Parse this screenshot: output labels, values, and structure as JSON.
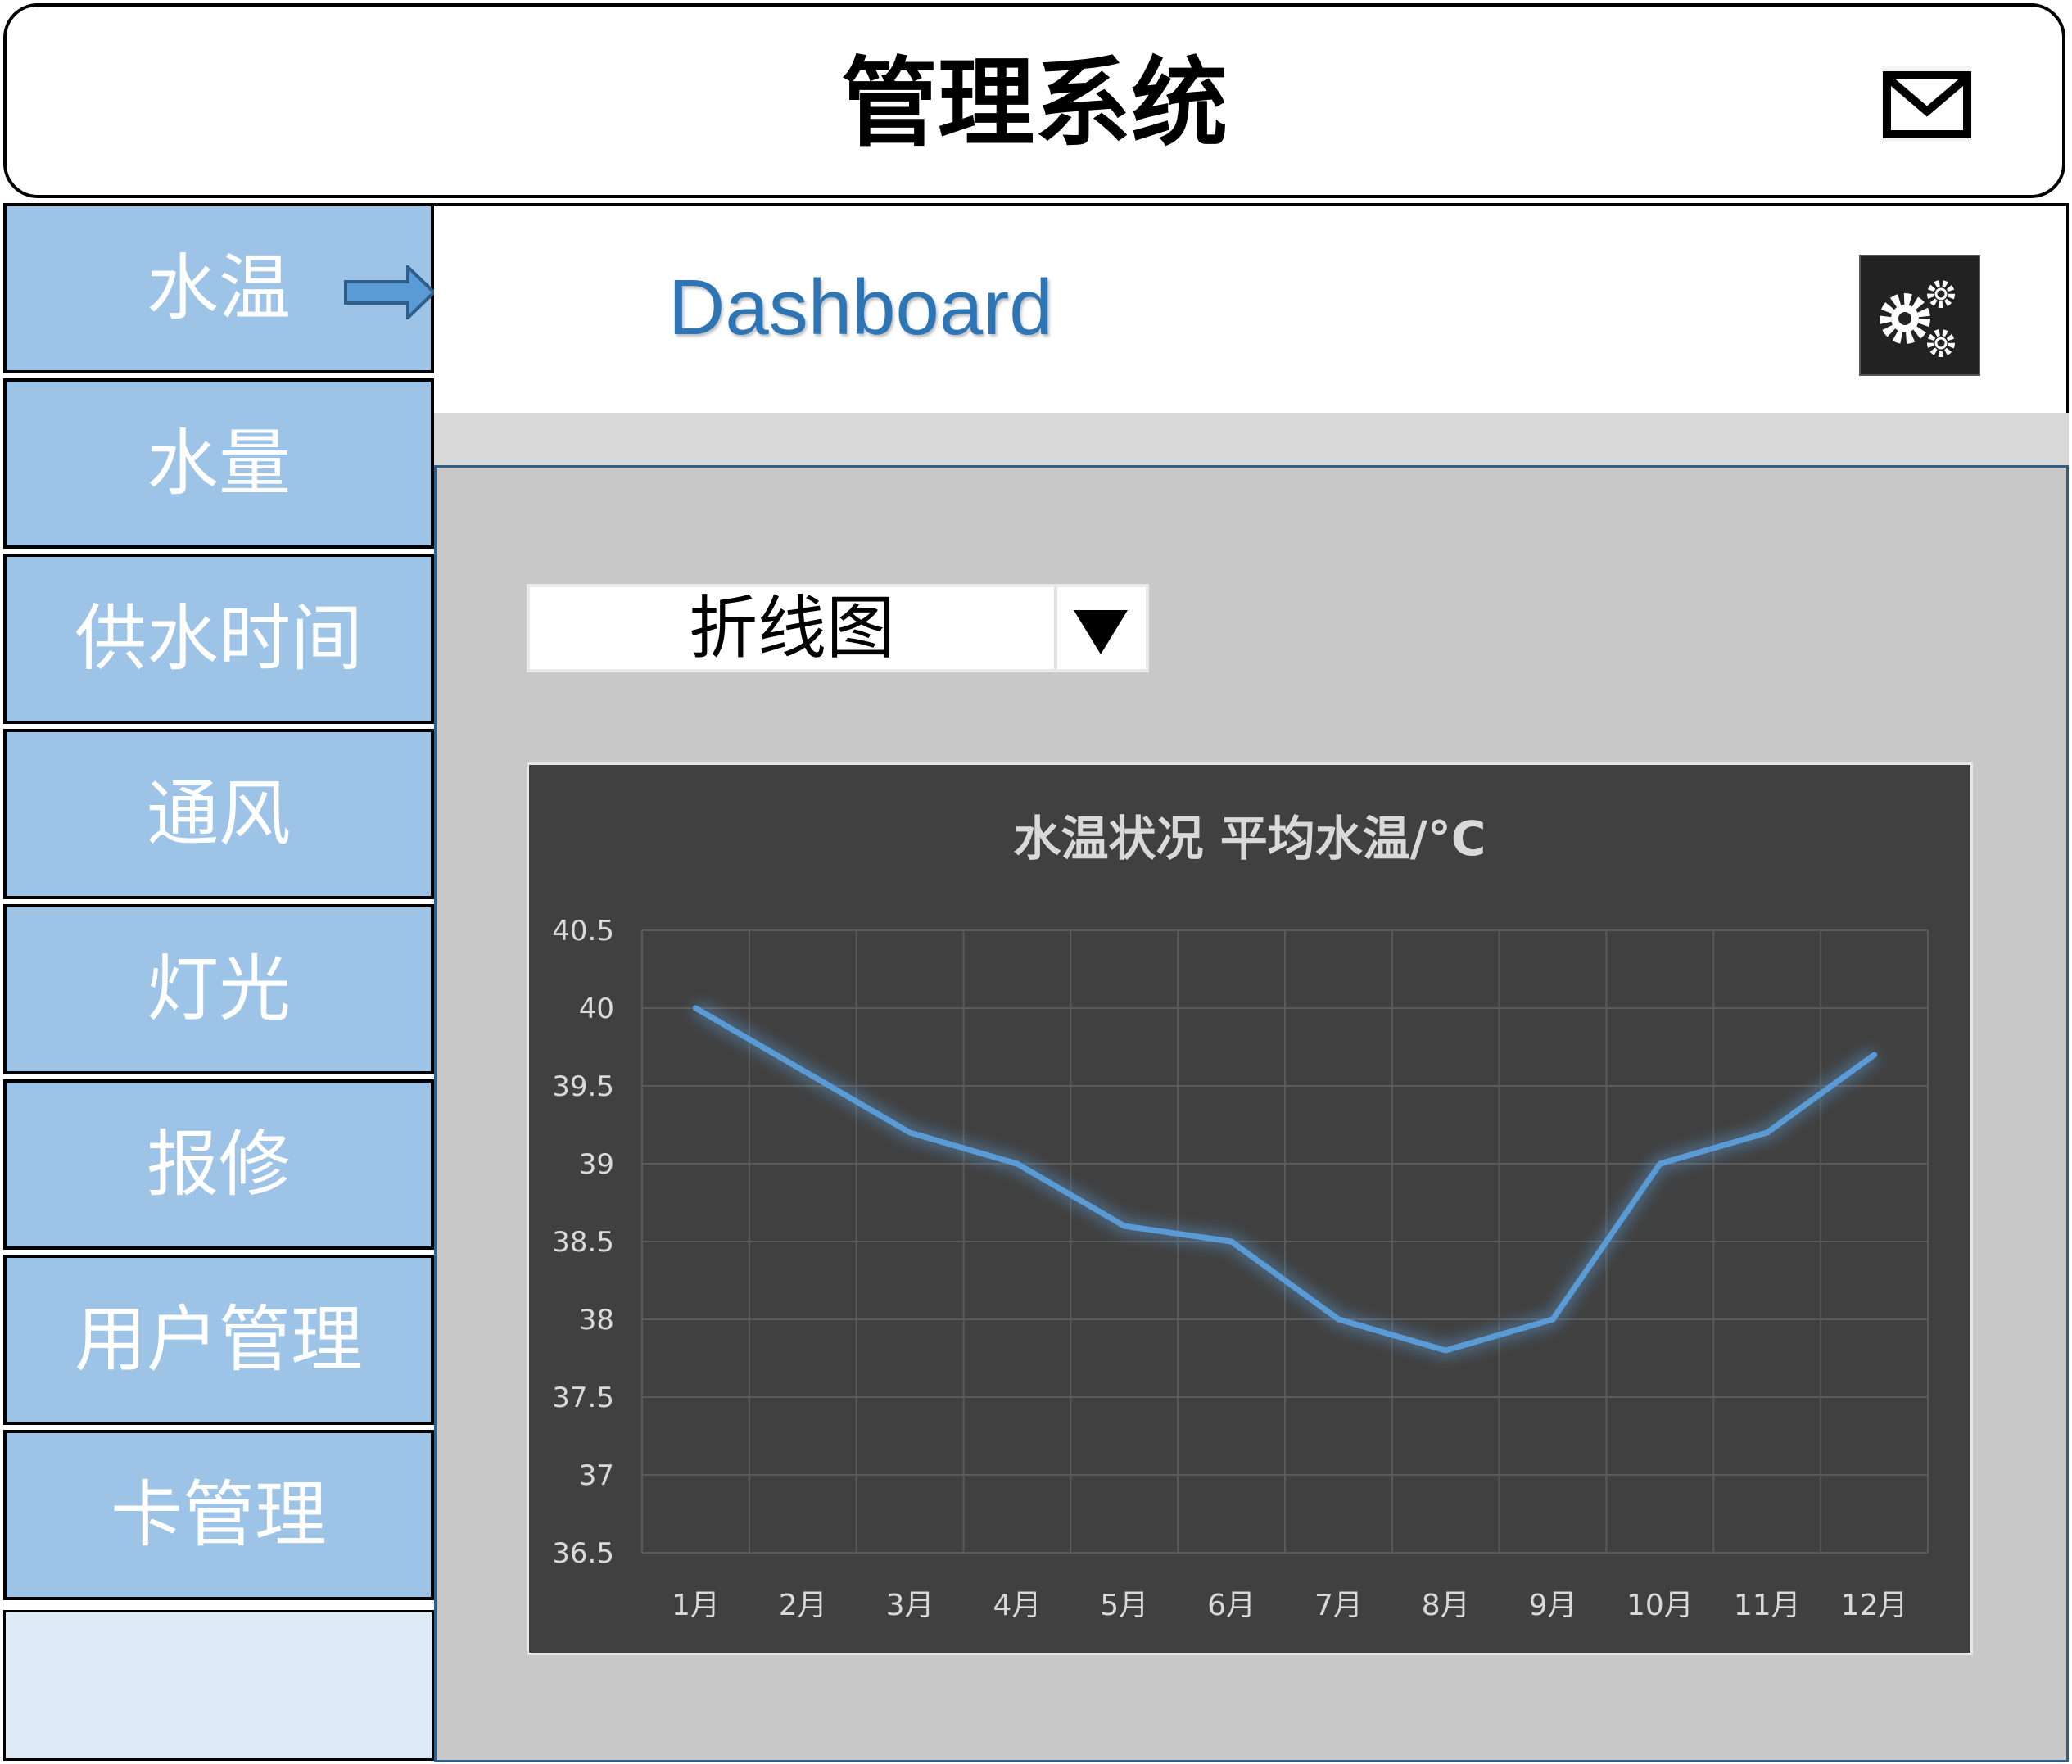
{
  "app": {
    "title": "管理系统"
  },
  "header": {
    "mail_icon": "mail-icon"
  },
  "sidebar": {
    "items": [
      {
        "label": "水温",
        "selected": true
      },
      {
        "label": "水量"
      },
      {
        "label": "供水时间"
      },
      {
        "label": "通风"
      },
      {
        "label": "灯光"
      },
      {
        "label": "报修"
      },
      {
        "label": "用户管理"
      },
      {
        "label": "卡管理"
      }
    ],
    "selected_indicator_icon": "arrow-right-icon"
  },
  "topbar": {
    "title": "Dashboard",
    "settings_icon": "gears-icon"
  },
  "chart_selector": {
    "value": "折线图",
    "dropdown_icon": "triangle-down-icon"
  },
  "colors": {
    "sidebar_bg": "#9dc3e6",
    "accent": "#2e75b6",
    "chart_bg": "#404040",
    "line": "#5b9bd5"
  },
  "chart_data": {
    "type": "line",
    "title": "水温状况 平均水温/°C",
    "categories": [
      "1月",
      "2月",
      "3月",
      "4月",
      "5月",
      "6月",
      "7月",
      "8月",
      "9月",
      "10月",
      "11月",
      "12月"
    ],
    "series": [
      {
        "values": [
          40,
          39.6,
          39.2,
          39.0,
          38.6,
          38.5,
          38.0,
          37.8,
          38.0,
          39.0,
          39.2,
          39.7
        ]
      }
    ],
    "ylim": [
      36.5,
      40.5
    ],
    "yticks": [
      "36.5",
      "37",
      "37.5",
      "38",
      "38.5",
      "39",
      "39.5",
      "40",
      "40.5"
    ],
    "grid": true,
    "legend": "none"
  }
}
